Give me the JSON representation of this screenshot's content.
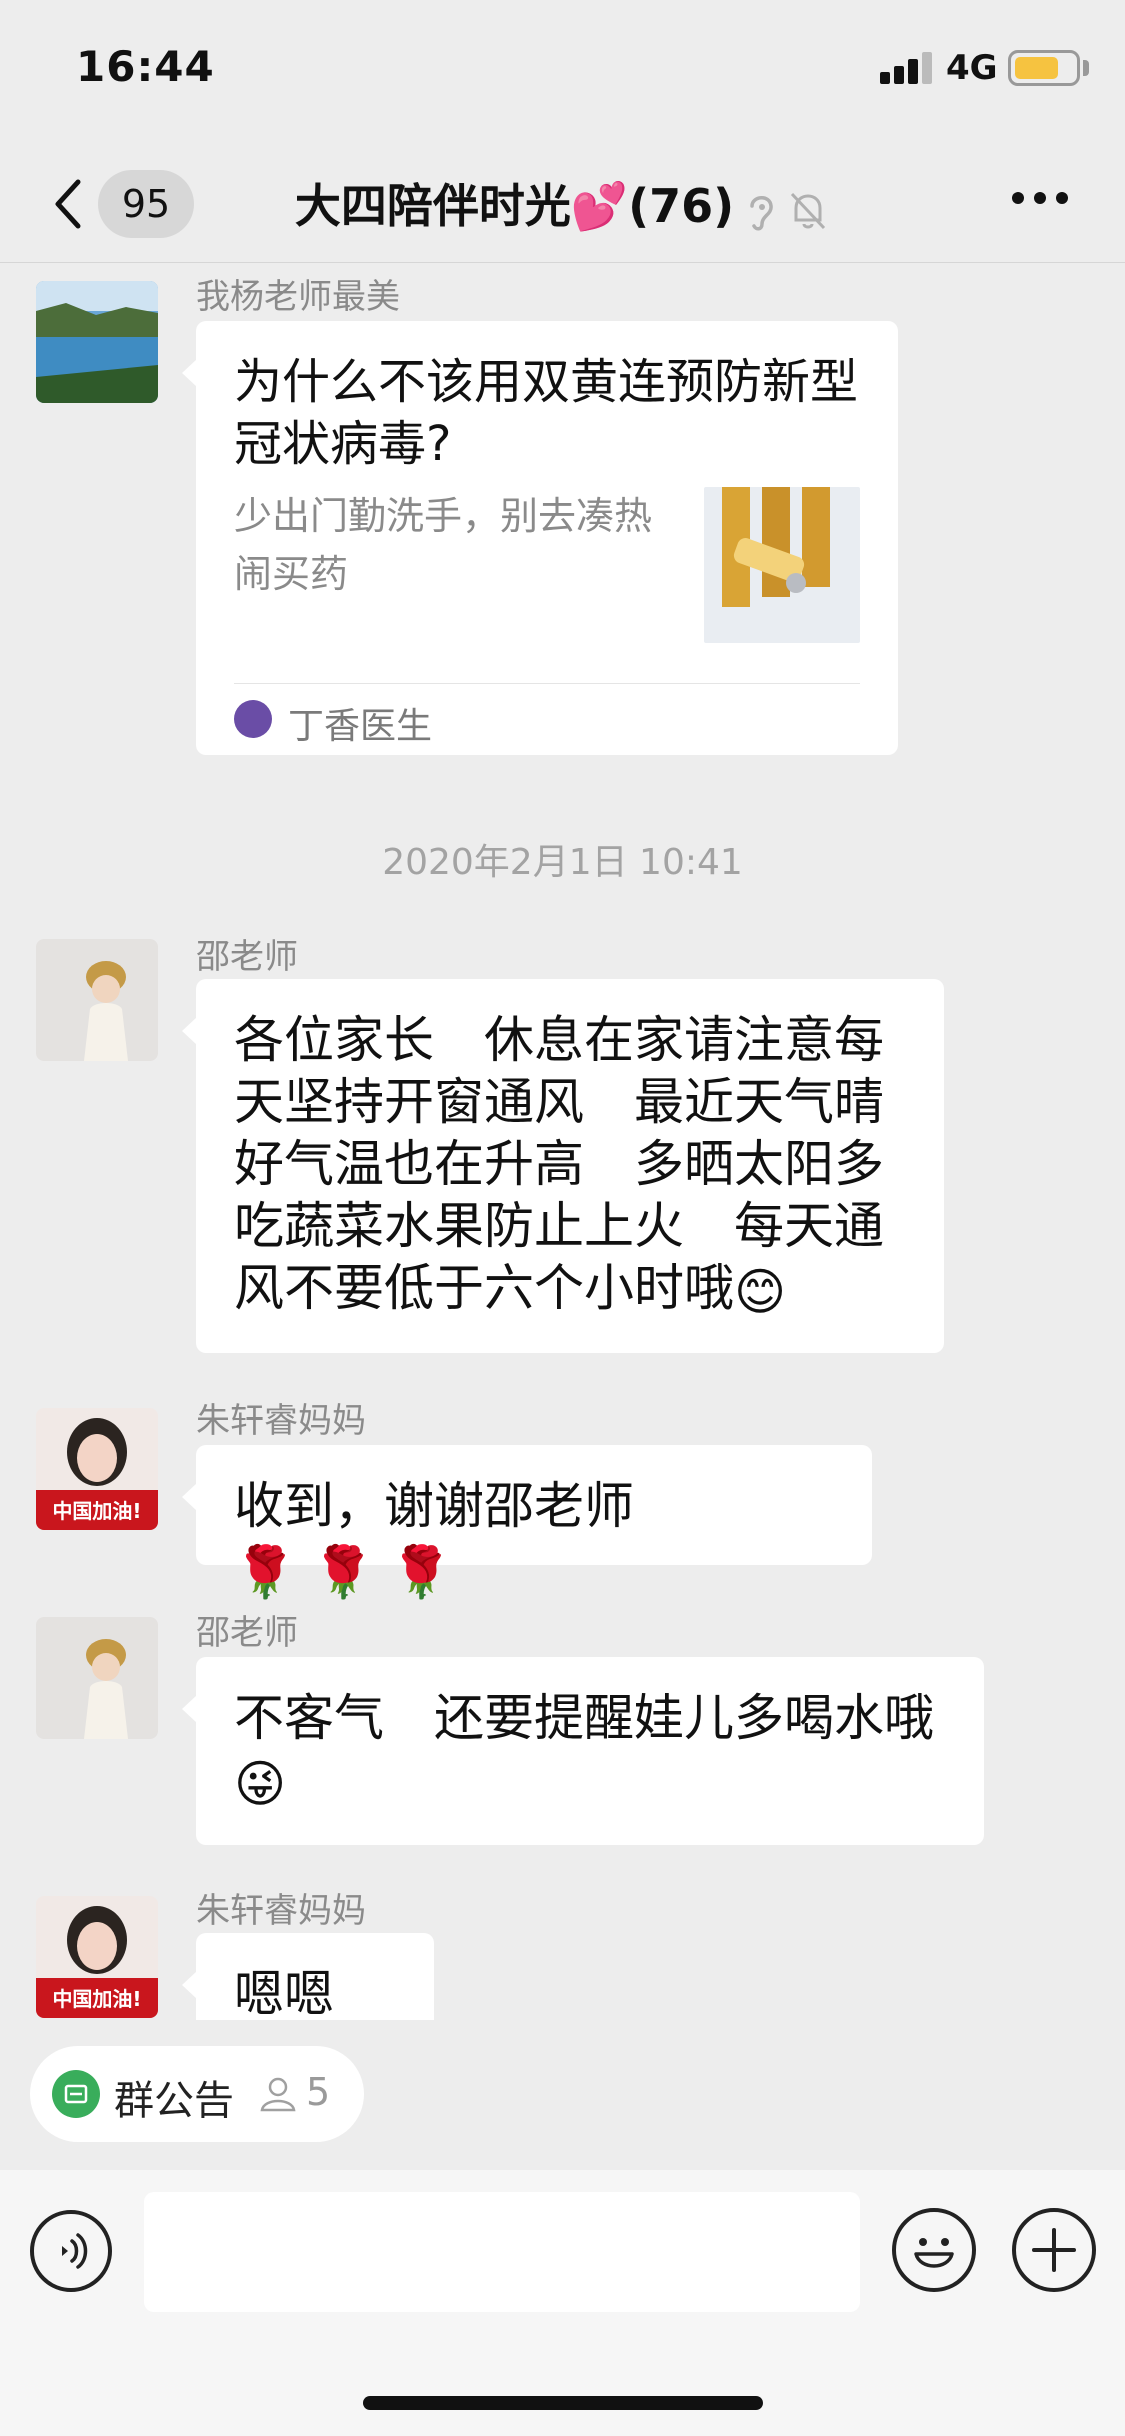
{
  "status_bar": {
    "time": "16:44",
    "network": "4G",
    "battery_level": 0.72
  },
  "nav": {
    "unread_count": "95",
    "title": "大四陪伴时光💕",
    "member_count": "(76)"
  },
  "messages": [
    {
      "sender": "我杨老师最美",
      "link_card": {
        "title": "为什么不该用双黄连预防新型冠状病毒?",
        "desc": "少出门勤洗手，别去凑热闹买药",
        "source": "丁香医生"
      }
    },
    {
      "timestamp": "2020年2月1日 10:41"
    },
    {
      "sender": "邵老师",
      "text": "各位家长　休息在家请注意每天坚持开窗通风　最近天气晴好气温也在升高　多晒太阳多吃蔬菜水果防止上火　每天通风不要低于六个小时哦",
      "emoji": "😊"
    },
    {
      "sender": "朱轩睿妈妈",
      "text": "收到，谢谢邵老师",
      "emoji": "🌹 🌹 🌹"
    },
    {
      "sender": "邵老师",
      "text": "不客气　还要提醒娃儿多喝水哦",
      "emoji": "😜"
    },
    {
      "sender": "朱轩睿妈妈",
      "text": "嗯嗯",
      "emoji": "👌"
    }
  ],
  "avatars": {
    "mom_avatar_text": "中国加油!"
  },
  "announcement": {
    "label": "群公告",
    "count": "5"
  },
  "input": {
    "placeholder": ""
  }
}
